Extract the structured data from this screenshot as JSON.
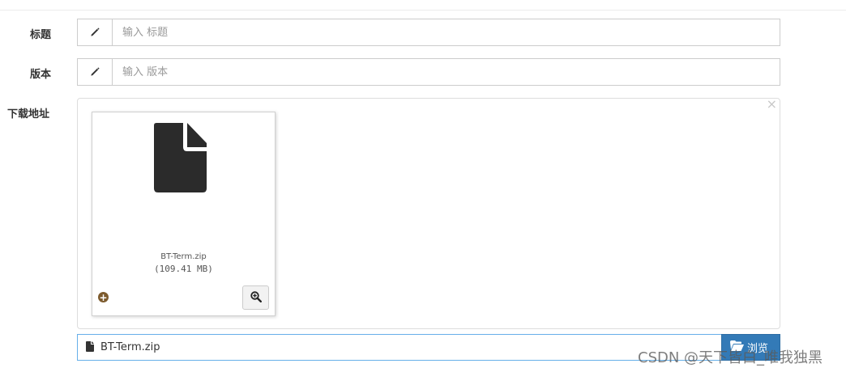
{
  "form": {
    "title": {
      "label": "标题",
      "placeholder": "输入 标题",
      "icon": "pencil-icon"
    },
    "version": {
      "label": "版本",
      "placeholder": "输入 版本",
      "icon": "pencil-icon"
    },
    "download": {
      "label": "下载地址",
      "preview": {
        "file_name": "BT-Term.zip",
        "file_size": "(109.41 MB)",
        "icon": "file-icon"
      },
      "caption_file_name": "BT-Term.zip",
      "browse_label": "浏览"
    }
  },
  "watermark": "CSDN @天下皆白_唯我独黑",
  "colors": {
    "primary": "#337ab7",
    "focus_border": "#66afe9",
    "file_icon": "#2b2b2b",
    "add_icon": "#7d5b2e"
  }
}
